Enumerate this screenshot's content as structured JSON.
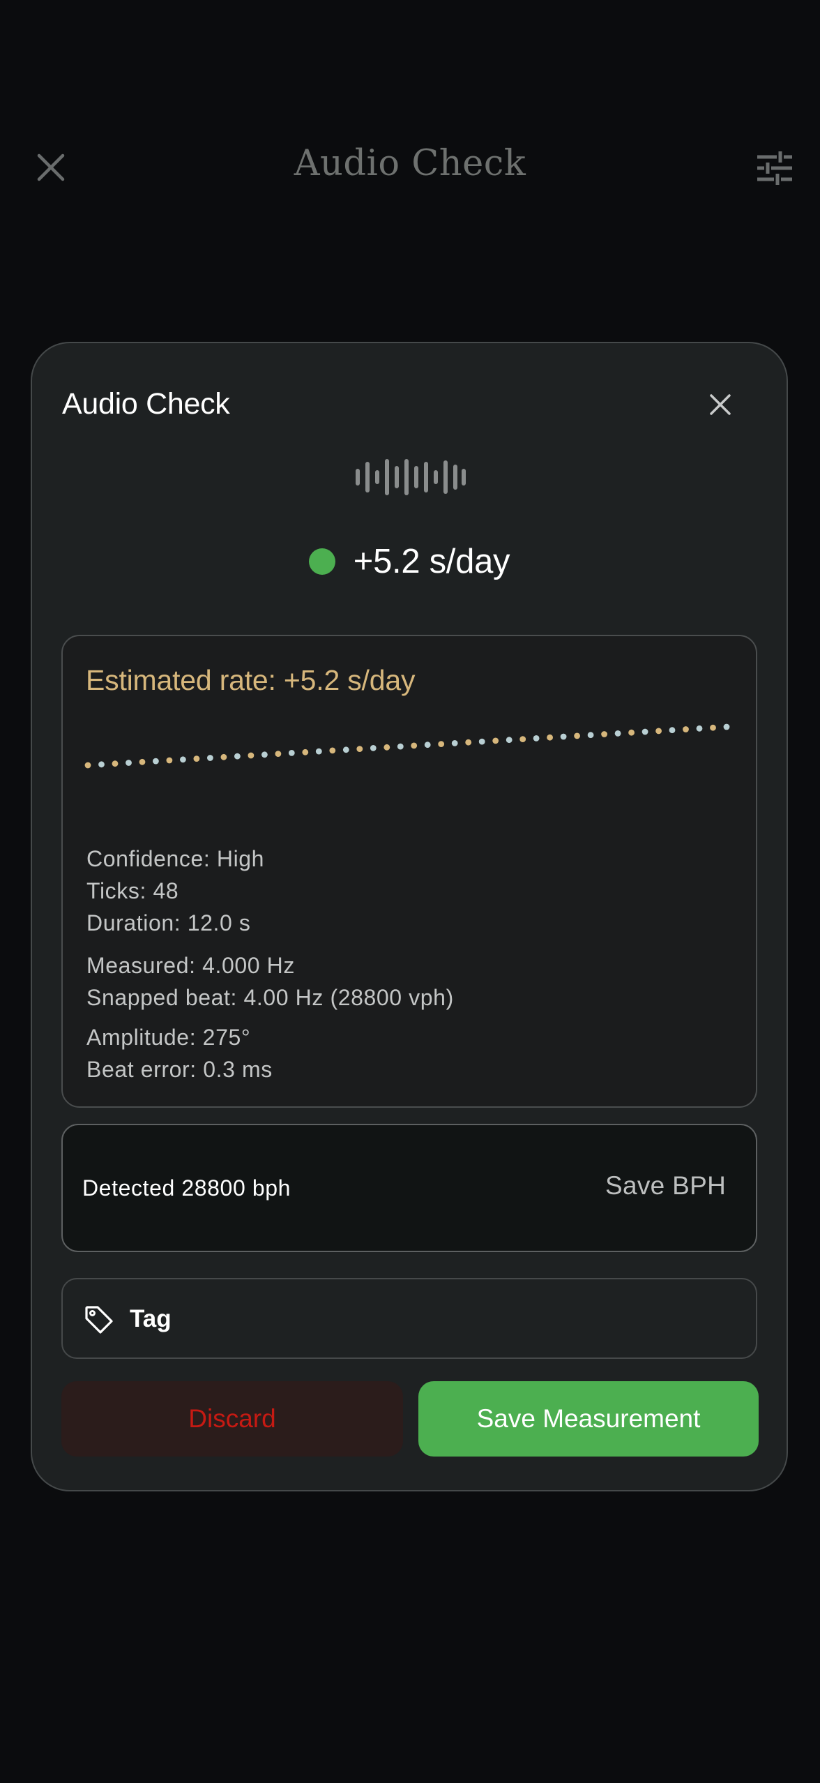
{
  "topbar": {
    "title": "Audio Check",
    "close_icon": "close-icon",
    "settings_icon": "sliders-icon"
  },
  "modal": {
    "title": "Audio Check",
    "close_icon": "close-icon",
    "waveform_icon": "waveform-icon",
    "status_color": "#4caf50",
    "rate": "+5.2 s/day"
  },
  "estimate": {
    "title": "Estimated rate: +5.2 s/day",
    "tick_count": 48,
    "tick_colors": [
      "#d7b77c",
      "#b9cfd3"
    ],
    "stats": {
      "confidence": "Confidence: High",
      "ticks": "Ticks: 48",
      "duration": "Duration: 12.0 s",
      "measured": "Measured: 4.000 Hz",
      "snapped": "Snapped beat: 4.00 Hz (28800 vph)",
      "amplitude": "Amplitude: 275°",
      "beat_error": "Beat error: 0.3 ms"
    }
  },
  "detected": {
    "text": "Detected 28800 bph",
    "save_label": "Save BPH"
  },
  "tag": {
    "label": "Tag",
    "icon": "tag-icon"
  },
  "actions": {
    "discard_label": "Discard",
    "save_label": "Save Measurement"
  },
  "colors": {
    "accent": "#4caf50",
    "gold": "#d7b77c",
    "danger": "#c61a13"
  }
}
